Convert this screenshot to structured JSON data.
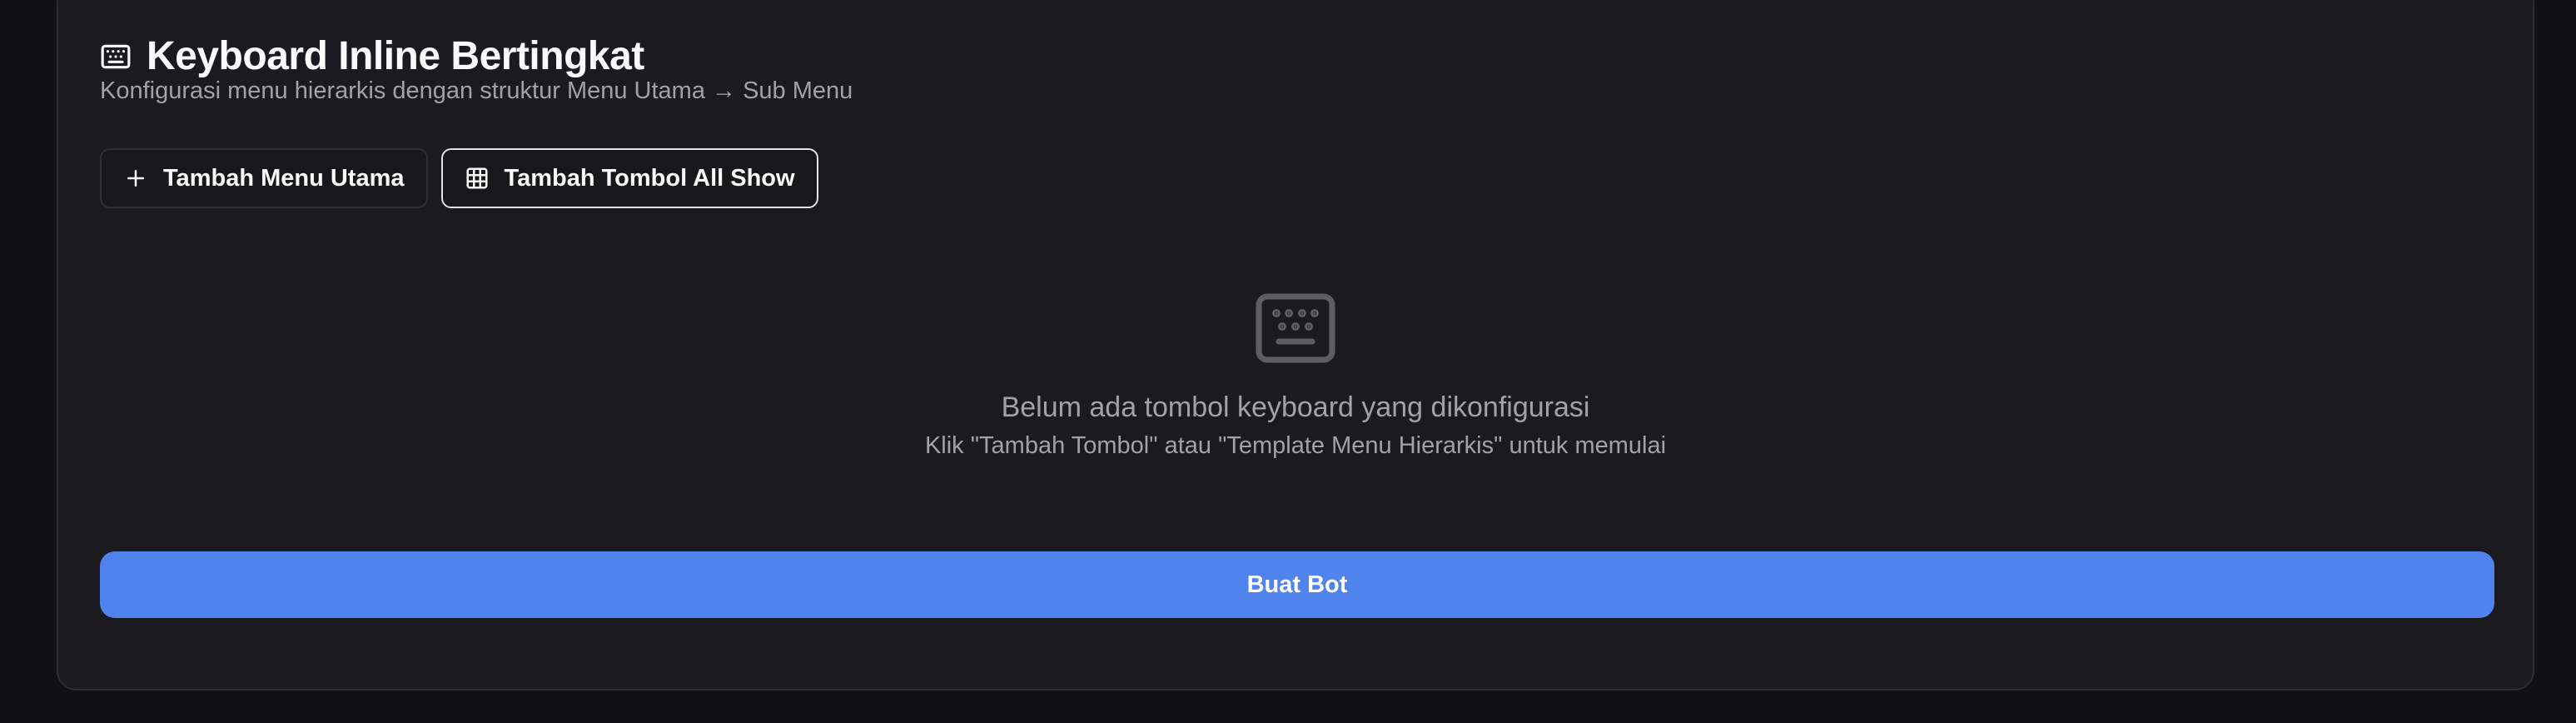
{
  "card": {
    "title": "Keyboard Inline Bertingkat",
    "title_icon": "keyboard-icon",
    "subtitle": "Konfigurasi menu hierarkis dengan struktur Menu Utama → Sub Menu"
  },
  "actions": {
    "add_main_menu": {
      "label": "Tambah Menu Utama",
      "icon": "plus-icon"
    },
    "add_all_show": {
      "label": "Tambah Tombol All Show",
      "icon": "grid-icon"
    }
  },
  "empty_state": {
    "icon": "keyboard-icon",
    "title": "Belum ada tombol keyboard yang dikonfigurasi",
    "hint": "Klik \"Tambah Tombol\" atau \"Template Menu Hierarkis\" untuk memulai"
  },
  "footer": {
    "create_bot_label": "Buat Bot"
  },
  "colors": {
    "background": "#111114",
    "card": "#1a1a1f",
    "primary": "#5183ec",
    "muted_text": "#a1a1aa"
  }
}
